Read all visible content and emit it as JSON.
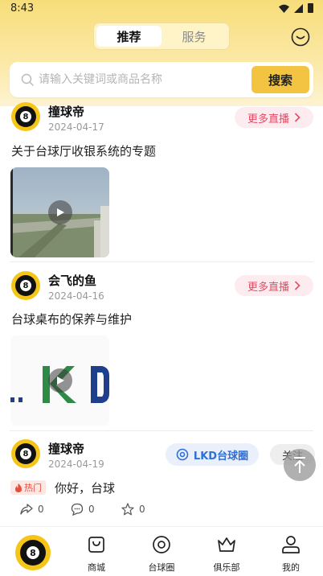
{
  "status_bar": {
    "time": "8:43"
  },
  "top_tabs": [
    {
      "label": "推荐",
      "active": true
    },
    {
      "label": "服务",
      "active": false
    }
  ],
  "search": {
    "placeholder": "请输入关键词或商品名称",
    "button_label": "搜索"
  },
  "posts": [
    {
      "username": "撞球帝",
      "date": "2024-04-17",
      "more_live_label": "更多直播",
      "title": "关于台球厅收银系统的专题"
    },
    {
      "username": "会飞的鱼",
      "date": "2024-04-16",
      "more_live_label": "更多直播",
      "title": "台球桌布的保养与维护",
      "thumb_text": "..KD"
    },
    {
      "username": "撞球帝",
      "date": "2024-04-19",
      "circle_tag": "LKD台球圈",
      "follow_label": "关注",
      "hot_label": "热门",
      "text": "你好，台球",
      "share_count": "0",
      "comment_count": "0",
      "like_count": "0"
    }
  ],
  "avatar_digit": "8",
  "bottom_nav": [
    {
      "label": "",
      "icon": "billiard-ball-icon"
    },
    {
      "label": "商城",
      "icon": "shop-bag-icon"
    },
    {
      "label": "台球圈",
      "icon": "circle-target-icon"
    },
    {
      "label": "俱乐部",
      "icon": "crown-icon"
    },
    {
      "label": "我的",
      "icon": "person-icon"
    }
  ],
  "colors": {
    "header_yellow": "#f7dd79",
    "accent_yellow": "#f2c442",
    "live_pink": "#e24a64",
    "circle_blue": "#2f6fd6",
    "hot_red": "#e84c3d"
  }
}
